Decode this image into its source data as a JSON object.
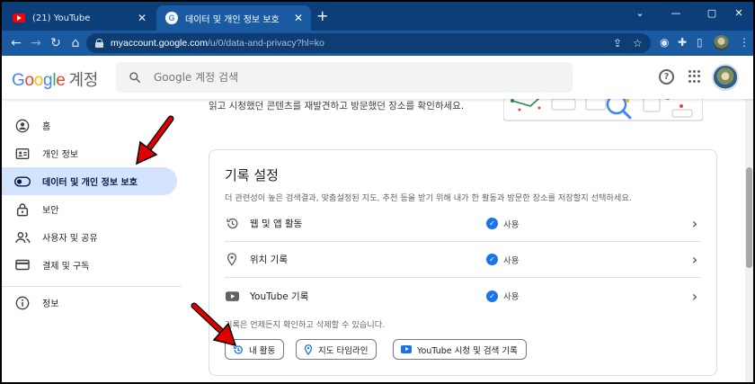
{
  "browser": {
    "tabs": [
      {
        "label": "(21) YouTube",
        "icon": "youtube-favicon"
      },
      {
        "label": "데이터 및 개인 정보 보호",
        "icon": "google-favicon"
      }
    ],
    "new_tab": "+",
    "url": {
      "host": "myaccount.google.com",
      "path": "/u/0/data-and-privacy?hl=ko"
    }
  },
  "header": {
    "logo": "Google",
    "product": "계정",
    "search_placeholder": "Google 계정 검색"
  },
  "sidebar": {
    "items": [
      {
        "label": "홈",
        "icon": "person-circle-icon"
      },
      {
        "label": "개인 정보",
        "icon": "id-card-icon"
      },
      {
        "label": "데이터 및 개인 정보 보호",
        "icon": "toggle-icon",
        "active": true
      },
      {
        "label": "보안",
        "icon": "lock-icon"
      },
      {
        "label": "사용자 및 공유",
        "icon": "people-icon"
      },
      {
        "label": "결제 및 구독",
        "icon": "credit-card-icon"
      },
      {
        "label": "정보",
        "icon": "info-icon"
      }
    ]
  },
  "main": {
    "intro": "읽고 시청했던 콘텐츠를 재발견하고 방문했던 장소를 확인하세요.",
    "history_card": {
      "title": "기록 설정",
      "description": "더 관련성이 높은 검색결과, 맞춤설정된 지도, 추천 등을 받기 위해 내가 한 활동과 방문한 장소를 저장할지 선택하세요.",
      "rows": [
        {
          "label": "웹 및 앱 활동",
          "icon": "history-icon",
          "status": "사용"
        },
        {
          "label": "위치 기록",
          "icon": "location-pin-icon",
          "status": "사용"
        },
        {
          "label": "YouTube 기록",
          "icon": "youtube-icon",
          "status": "사용"
        }
      ],
      "note": "기록은 언제든지 확인하고 삭제할 수 있습니다.",
      "chips": [
        {
          "label": "내 활동",
          "icon": "history-icon"
        },
        {
          "label": "지도 타임라인",
          "icon": "location-pin-icon"
        },
        {
          "label": "YouTube 시청 및 검색 기록",
          "icon": "youtube-icon"
        }
      ]
    }
  },
  "colors": {
    "accent": "#1a73e8",
    "active_nav_bg": "#d3e3fd",
    "annotation_arrow": "#e00000",
    "browser_chrome": "#1a5aa0"
  }
}
